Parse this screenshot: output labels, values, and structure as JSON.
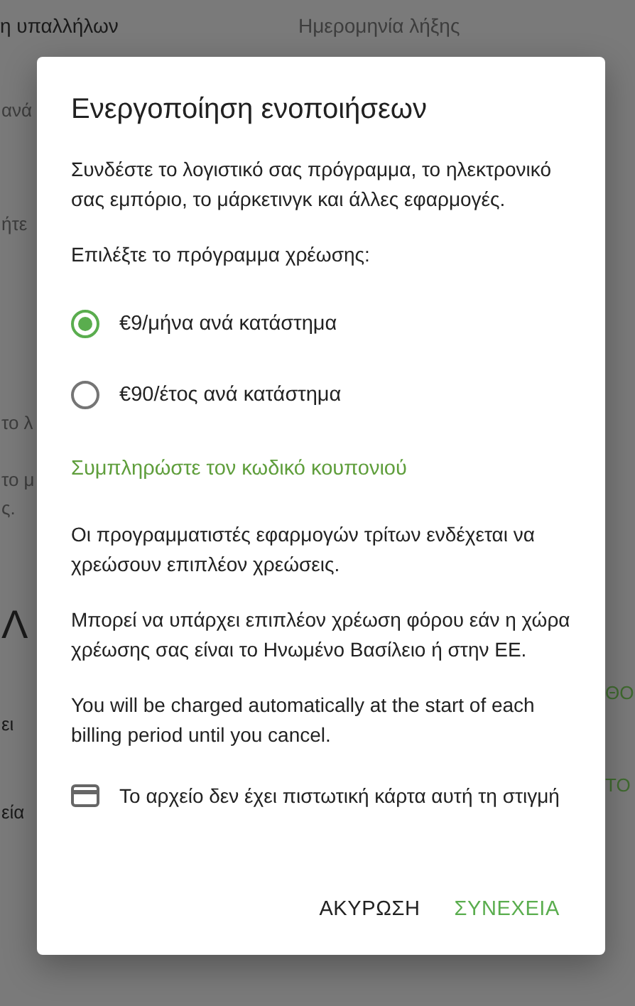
{
  "background": {
    "top_left": [
      {
        "text": "η υπαλλήλων",
        "kind": "heading"
      }
    ],
    "top_right": [
      {
        "text": "Ημερομηνία λήξης",
        "kind": "body"
      }
    ],
    "left_strip": [
      {
        "text": "ανά",
        "kind": "body"
      },
      {
        "text": "ήτε",
        "kind": "body"
      },
      {
        "text": "το λ",
        "kind": "body"
      },
      {
        "text": "το μ",
        "kind": "body"
      },
      {
        "text": "ς.",
        "kind": "body"
      },
      {
        "text": "Λ",
        "kind": "large"
      },
      {
        "text": "ει",
        "kind": "heading"
      },
      {
        "text": "εία",
        "kind": "heading"
      }
    ],
    "right_strip": [
      {
        "text": "ΘΟ"
      },
      {
        "text": "ΤΟ"
      }
    ]
  },
  "dialog": {
    "title": "Ενεργοποίηση ενοποιήσεων",
    "intro": "Συνδέστε το λογιστικό σας πρόγραμμα, το ηλεκτρονικό σας εμπόριο, το μάρκετινγκ και άλλες εφαρμογές.",
    "plan_label": "Επιλέξτε το πρόγραμμα χρέωσης:",
    "plans": [
      {
        "label": "€9/μήνα ανά κατάστημα",
        "selected": true
      },
      {
        "label": "€90/έτος ανά κατάστημα",
        "selected": false
      }
    ],
    "coupon_link": "Συμπληρώστε τον κωδικό κουπονιού",
    "notes": [
      "Οι προγραμματιστές εφαρμογών τρίτων ενδέχεται να χρεώσουν επιπλέον χρεώσεις.",
      "Μπορεί να υπάρχει επιπλέον χρέωση φόρου εάν η χώρα χρέωσης σας είναι το Ηνωμένο Βασίλειο ή στην ΕΕ.",
      "You will be charged automatically at the start of each billing period until you cancel."
    ],
    "card_note": "Το αρχείο δεν έχει πιστωτική κάρτα αυτή τη στιγμή",
    "buttons": [
      {
        "label": "ΑΚΥΡΩΣΗ",
        "kind": "cancel"
      },
      {
        "label": "ΣΥΝΕΧΕΙΑ",
        "kind": "confirm"
      }
    ]
  }
}
